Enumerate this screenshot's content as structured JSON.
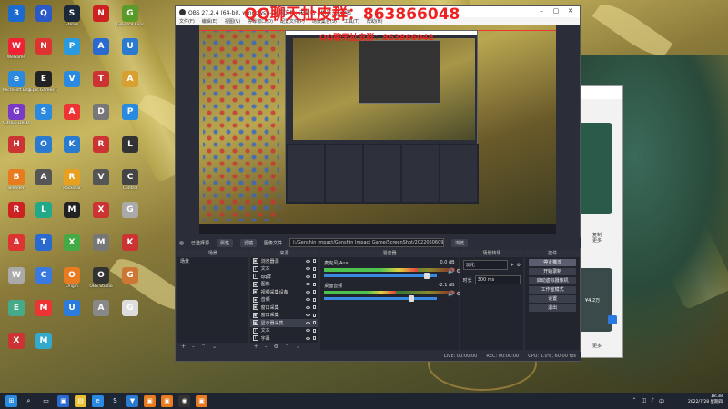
{
  "desktop": {
    "columns": [
      [
        {
          "label": "",
          "color": "#1a6ad0",
          "glyph": "3"
        },
        {
          "label": "WeGame",
          "color": "#e23",
          "glyph": "W"
        },
        {
          "label": "Microsoft Edge",
          "color": "#2a8ae0",
          "glyph": "e"
        },
        {
          "label": "GitHub Desktop",
          "color": "#7a3ac8",
          "glyph": "G"
        },
        {
          "label": "",
          "color": "#c33",
          "glyph": "H"
        },
        {
          "label": "Blender",
          "color": "#e87a20",
          "glyph": "B"
        },
        {
          "label": "",
          "color": "#c22",
          "glyph": "R"
        },
        {
          "label": "",
          "color": "#d33",
          "glyph": "A"
        },
        {
          "label": "",
          "color": "#aaa",
          "glyph": "W"
        },
        {
          "label": "",
          "color": "#4a8",
          "glyph": "E"
        },
        {
          "label": "",
          "color": "#c33",
          "glyph": "X"
        }
      ],
      [
        {
          "label": "",
          "color": "#2a5ac8",
          "glyph": "Q"
        },
        {
          "label": "",
          "color": "#d33",
          "glyph": "N"
        },
        {
          "label": "Epic Games Launcher",
          "color": "#222",
          "glyph": "E"
        },
        {
          "label": "",
          "color": "#2a8ae0",
          "glyph": "S"
        },
        {
          "label": "",
          "color": "#2a7ad0",
          "glyph": "O"
        },
        {
          "label": "",
          "color": "#555",
          "glyph": "A"
        },
        {
          "label": "",
          "color": "#2a8",
          "glyph": "L"
        },
        {
          "label": "",
          "color": "#2a6ad0",
          "glyph": "T"
        },
        {
          "label": "",
          "color": "#3a7ae0",
          "glyph": "C"
        },
        {
          "label": "",
          "color": "#e33",
          "glyph": "M"
        },
        {
          "label": "",
          "color": "#3ac",
          "glyph": "M"
        }
      ],
      [
        {
          "label": "Steam",
          "color": "#1b2838",
          "glyph": "S"
        },
        {
          "label": "",
          "color": "#2a9ae0",
          "glyph": "P"
        },
        {
          "label": "",
          "color": "#2a8ae0",
          "glyph": "V"
        },
        {
          "label": "",
          "color": "#e33",
          "glyph": "A"
        },
        {
          "label": "",
          "color": "#2a7ad0",
          "glyph": "K"
        },
        {
          "label": "Rockstar",
          "color": "#e8a020",
          "glyph": "R"
        },
        {
          "label": "",
          "color": "#222",
          "glyph": "M"
        },
        {
          "label": "",
          "color": "#4a4",
          "glyph": "X"
        },
        {
          "label": "Origin",
          "color": "#e87a20",
          "glyph": "O"
        },
        {
          "label": "",
          "color": "#2a7ae0",
          "glyph": "U"
        }
      ],
      [
        {
          "label": "",
          "color": "#c22",
          "glyph": "N"
        },
        {
          "label": "",
          "color": "#2a6ad0",
          "glyph": "A"
        },
        {
          "label": "",
          "color": "#c33",
          "glyph": "T"
        },
        {
          "label": "",
          "color": "#777",
          "glyph": "D"
        },
        {
          "label": "",
          "color": "#c33",
          "glyph": "R"
        },
        {
          "label": "",
          "color": "#555",
          "glyph": "V"
        },
        {
          "label": "",
          "color": "#c33",
          "glyph": "X"
        },
        {
          "label": "",
          "color": "#777",
          "glyph": "M"
        },
        {
          "label": "OBS Studio",
          "color": "#333",
          "glyph": "O"
        },
        {
          "label": "",
          "color": "#888",
          "glyph": "A"
        }
      ],
      [
        {
          "label": "GeForce Experience",
          "color": "#5a9a2a",
          "glyph": "G"
        },
        {
          "label": "",
          "color": "#2a7ad0",
          "glyph": "U"
        },
        {
          "label": "",
          "color": "#d8a030",
          "glyph": "A"
        },
        {
          "label": "",
          "color": "#2a8ae0",
          "glyph": "P"
        },
        {
          "label": "",
          "color": "#333",
          "glyph": "L"
        },
        {
          "label": "Control",
          "color": "#444",
          "glyph": "C"
        },
        {
          "label": "",
          "color": "#aaa",
          "glyph": "G"
        },
        {
          "label": "",
          "color": "#c33",
          "glyph": "K"
        },
        {
          "label": "",
          "color": "#c73",
          "glyph": "G"
        },
        {
          "label": "",
          "color": "#ddd",
          "glyph": "G"
        }
      ]
    ]
  },
  "overlay": {
    "qq_title": "QQ聊天扯皮群：863866048",
    "qq_title_small": "QQ聊天扯皮群：863866048"
  },
  "obs": {
    "title": "OBS 27.2.4 (64-bit, windows) - 配置文件: 未命名 - 场景: 未命名",
    "menu": [
      "文件(F)",
      "编辑(E)",
      "视图(V)",
      "停靠窗口(D)",
      "配置文件(P)",
      "场景集合(S)",
      "工具(T)",
      "帮助(H)"
    ],
    "sourcebar": {
      "label": "已选择源",
      "props_label": "属性",
      "filter_label": "滤镜",
      "image_label": "图像文件",
      "path": "I:/Genshin Impact/Genshin Impact Game/ScreenShot/20220606090.png",
      "browse_label": "浏览"
    },
    "scenes": {
      "header": "场景",
      "items": [
        "场景"
      ]
    },
    "sources": {
      "header": "来源",
      "items": [
        {
          "icon": "▣",
          "label": "浏览器源"
        },
        {
          "icon": "T",
          "label": "文本"
        },
        {
          "icon": "T",
          "label": "qq群"
        },
        {
          "icon": "▣",
          "label": "图像"
        },
        {
          "icon": "▣",
          "label": "视频采集设备"
        },
        {
          "icon": "◉",
          "label": "音频"
        },
        {
          "icon": "▣",
          "label": "窗口采集"
        },
        {
          "icon": "▣",
          "label": "窗口采集"
        },
        {
          "icon": "▣",
          "label": "显示器采集"
        },
        {
          "icon": "T",
          "label": "文本"
        },
        {
          "icon": "T",
          "label": "字幕"
        }
      ],
      "selected_index": 8
    },
    "mixer": {
      "header": "混音器",
      "tracks": [
        {
          "name": "麦克风/Aux",
          "db": "0.0 dB",
          "level": 0.72,
          "volume": 0.92
        },
        {
          "name": "桌面音频",
          "db": "-2.1 dB",
          "level": 0.55,
          "volume": 0.78
        }
      ]
    },
    "transitions": {
      "header": "场景转场",
      "type": "淡化",
      "duration_label": "时长",
      "duration": "300 ms"
    },
    "controls": {
      "header": "控件",
      "buttons": [
        "停止推流",
        "开始录制",
        "启动虚拟摄像机",
        "工作室模式",
        "设置",
        "退出"
      ],
      "active_index": 0
    },
    "status": {
      "live": "LIVE: 00:00:00",
      "rec": "REC: 00:00:00",
      "cpu": "CPU: 1.0%, 60.00 fps"
    }
  },
  "sidewin": {
    "texts": [
      "复制",
      "更多",
      "¥4.2万",
      "更多"
    ]
  },
  "taskbar": {
    "time": "18:38",
    "date": "2022/7/28 星期四",
    "apps": [
      {
        "name": "start",
        "color": "#2a8ae0",
        "glyph": "⊞"
      },
      {
        "name": "search",
        "color": "transparent",
        "glyph": "⌕"
      },
      {
        "name": "task-view",
        "color": "transparent",
        "glyph": "▭"
      },
      {
        "name": "app-1",
        "color": "#2a6ad0",
        "glyph": "▣"
      },
      {
        "name": "app-2",
        "color": "#e8c030",
        "glyph": "▤"
      },
      {
        "name": "app-3",
        "color": "#2a8ae0",
        "glyph": "e"
      },
      {
        "name": "app-4",
        "color": "#1b2838",
        "glyph": "S"
      },
      {
        "name": "app-5",
        "color": "#2a7ad0",
        "glyph": "▼"
      },
      {
        "name": "app-6",
        "color": "#e87a20",
        "glyph": "▣"
      },
      {
        "name": "app-7",
        "color": "#e87a20",
        "glyph": "▣"
      },
      {
        "name": "app-8",
        "color": "#333",
        "glyph": "◉"
      },
      {
        "name": "app-9",
        "color": "#e87a20",
        "glyph": "▣"
      }
    ]
  }
}
